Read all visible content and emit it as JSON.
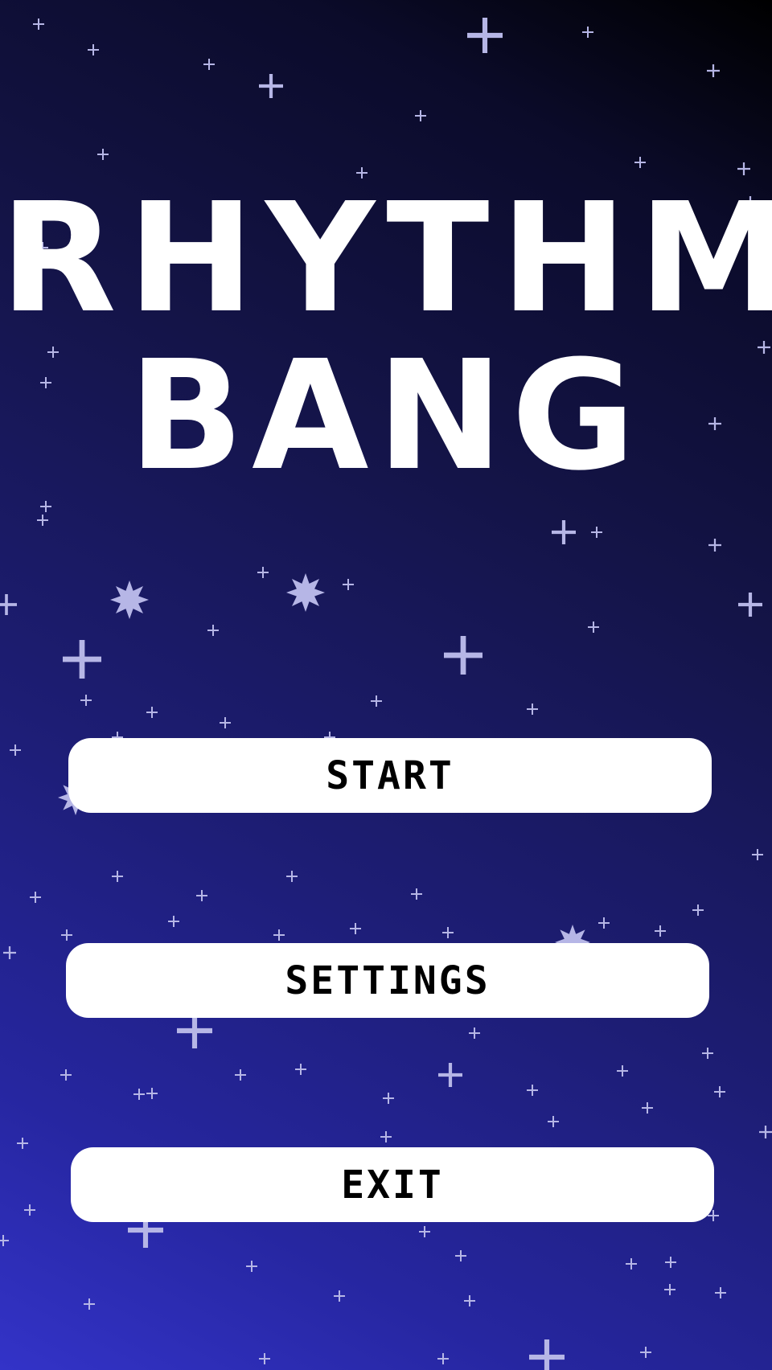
{
  "title": {
    "line1": "RHYTHM",
    "line2": "BANG"
  },
  "menu": {
    "start_label": "START",
    "settings_label": "SETTINGS",
    "exit_label": "EXIT"
  },
  "colors": {
    "background_top": "#000000",
    "background_bottom": "#3333c8",
    "star": "#b6b6e6",
    "button_fill": "#ffffff",
    "button_text": "#000000",
    "title_text": "#ffffff"
  },
  "icons": [
    "sparkle-star-icon",
    "burst-star-icon"
  ]
}
